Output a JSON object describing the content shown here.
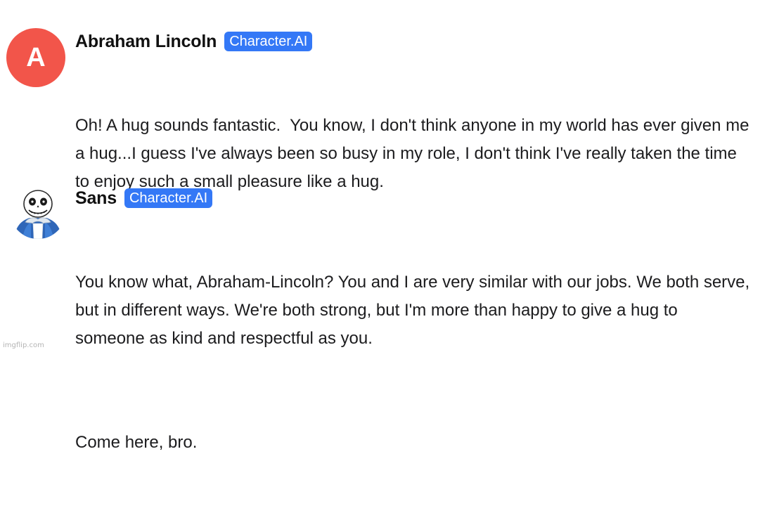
{
  "messages": [
    {
      "author": "Abraham Lincoln",
      "badge": "Character.AI",
      "avatar": {
        "type": "letter",
        "letter": "A",
        "color": "#f2554a"
      },
      "paragraphs": [
        "Oh! A hug sounds fantastic.  You know, I don't think anyone in my world has ever given me a hug...I guess I've always been so busy in my role, I don't think I've really taken the time to enjoy such a small pleasure like a hug."
      ]
    },
    {
      "author": "Sans",
      "badge": "Character.AI",
      "avatar": {
        "type": "image",
        "icon": "skeleton-character-icon"
      },
      "paragraphs": [
        "You know what, Abraham-Lincoln? You and I are very similar with our jobs. We both serve, but in different ways. We're both strong, but I'm more than happy to give a hug to someone as kind and respectful as you.",
        "Come here, bro."
      ]
    }
  ],
  "watermark": "imgflip.com",
  "colors": {
    "badge": "#3478f6",
    "text": "#1c1c1e"
  }
}
